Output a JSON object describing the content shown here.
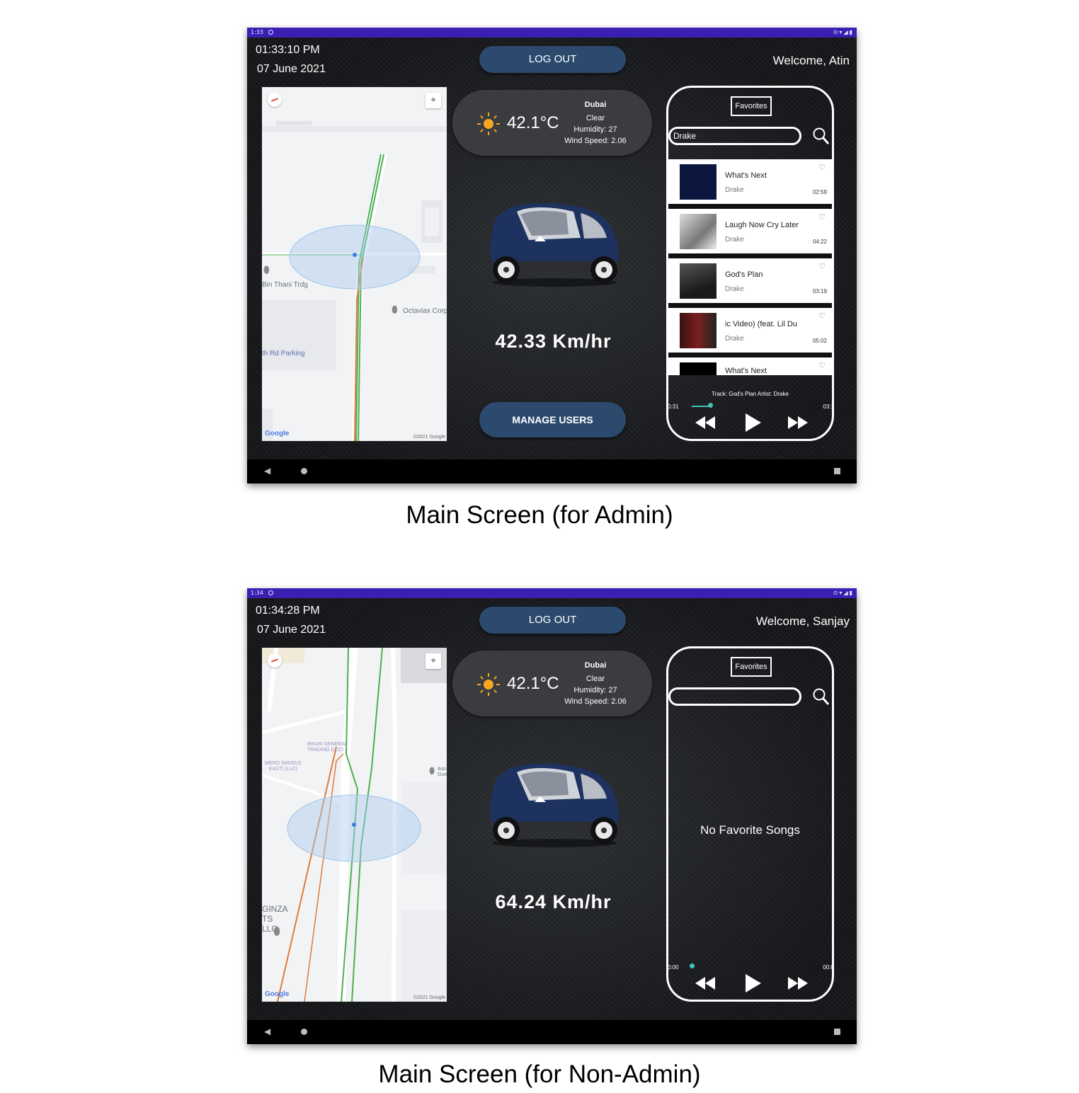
{
  "screens": [
    {
      "status_time": "1:33",
      "clock": "01:33:10 PM",
      "date": "07 June 2021",
      "welcome": "Welcome, Atin",
      "logout_label": "LOG OUT",
      "manage_label": "MANAGE USERS",
      "map": {
        "labels": [
          "Bin Thani Trdg",
          "Octaviax Corp",
          "th Rd Parking"
        ],
        "google": "Google",
        "copyright": "©2021 Google"
      },
      "weather": {
        "city": "Dubai",
        "temp": "42.1°C",
        "condition": "Clear",
        "humidity": "Humidity: 27",
        "wind": "Wind Speed: 2.06"
      },
      "speed": "42.33  Km/hr",
      "player": {
        "favorites_label": "Favorites",
        "search_value": "Drake",
        "songs": [
          {
            "title": "What's Next",
            "artist": "Drake",
            "duration": "02:59"
          },
          {
            "title": "Laugh Now Cry Later",
            "artist": "Drake",
            "duration": "04:22"
          },
          {
            "title": "God's Plan",
            "artist": "Drake",
            "duration": "03:19"
          },
          {
            "title": "ic Video) (feat. Lil Du",
            "artist": "Drake",
            "duration": "05:02"
          },
          {
            "title": "What's Next",
            "artist": "",
            "duration": ""
          }
        ],
        "track_info": "Track: God's Plan Artist: Drake",
        "time_start": "0:31",
        "time_end": "03:1",
        "progress": 0.16
      },
      "caption": "Main Screen (for Admin)"
    },
    {
      "status_time": "1:34",
      "clock": "01:34:28 PM",
      "date": "07 June 2021",
      "welcome": "Welcome, Sanjay",
      "logout_label": "LOG OUT",
      "map": {
        "labels": [
          "RIKAN GENERAL TRADING (LLC)",
          "MERO (MIDDLE EAST) (LLC)",
          "Aso Gue",
          "GINZA TS LLC"
        ],
        "google": "Google",
        "copyright": "©2021 Google"
      },
      "weather": {
        "city": "Dubai",
        "temp": "42.1°C",
        "condition": "Clear",
        "humidity": "Humidity: 27",
        "wind": "Wind Speed: 2.06"
      },
      "speed": "64.24  Km/hr",
      "player": {
        "favorites_label": "Favorites",
        "search_value": "",
        "no_favorites": "No Favorite Songs",
        "time_start": "0:00",
        "time_end": "00:0",
        "progress": 0.0
      },
      "caption": "Main Screen (for Non-Admin)"
    }
  ],
  "colors": {
    "status_bar": "#3b1fb3",
    "button": "#2c4a6e",
    "accent": "#3fc6b5",
    "sun": "#f5a623"
  },
  "icons": [
    "sun-icon",
    "search-icon",
    "heart-icon",
    "rewind-icon",
    "play-icon",
    "fast-forward-icon",
    "compass-icon",
    "my-location-icon",
    "back-icon",
    "home-icon",
    "recents-icon",
    "map-pin-icon"
  ]
}
